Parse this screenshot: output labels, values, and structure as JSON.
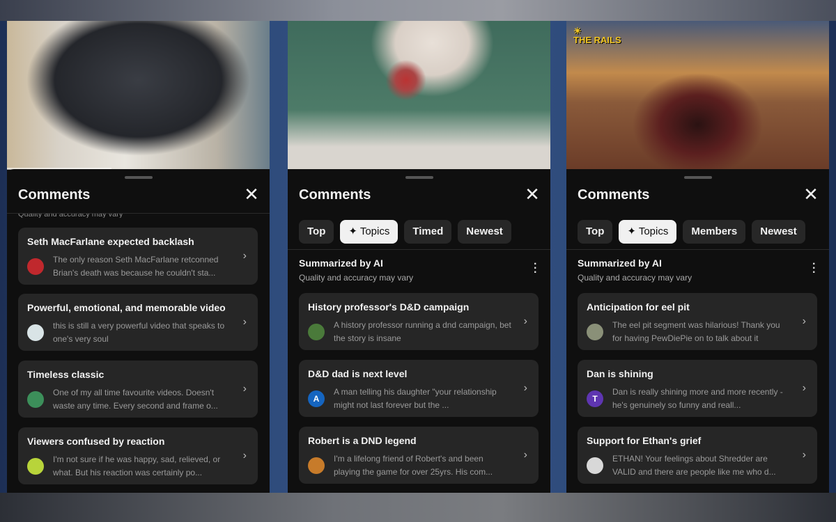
{
  "header_title": "Comments",
  "ai": {
    "title": "Summarized by AI",
    "subtitle": "Quality and accuracy may vary"
  },
  "panels": [
    {
      "chips": [],
      "cards": [
        {
          "title": "Seth MacFarlane expected backlash",
          "text": "The only reason Seth MacFarlane retconned Brian's death was because he couldn't sta...",
          "avatar": "",
          "avatar_color": "#c0282d"
        },
        {
          "title": "Powerful, emotional, and memorable video",
          "text": "this is still a very powerful video that speaks to one's very soul",
          "avatar": "",
          "avatar_color": "#d9e4e6"
        },
        {
          "title": "Timeless classic",
          "text": "One of my all time favourite videos. Doesn't waste any time. Every second and frame o...",
          "avatar": "",
          "avatar_color": "#3c8f5a"
        },
        {
          "title": "Viewers confused by reaction",
          "text": "I'm not sure if he was happy, sad, relieved, or what. But his reaction was certainly po...",
          "avatar": "",
          "avatar_color": "#b8d43a"
        }
      ]
    },
    {
      "chips": [
        "Top",
        "Topics",
        "Timed",
        "Newest"
      ],
      "active_chip": "Topics",
      "cards": [
        {
          "title": "History professor's D&D campaign",
          "text": "A history professor running a dnd campaign, bet the story is insane",
          "avatar": "",
          "avatar_color": "#4a7a3a"
        },
        {
          "title": "D&D dad is next level",
          "text": "A man telling his daughter \"your relationship might not last forever but the ...",
          "avatar": "A",
          "avatar_color": "#1565c0"
        },
        {
          "title": "Robert is a DND legend",
          "text": "I'm a lifelong friend of Robert's and been playing the game for over 25yrs. His com...",
          "avatar": "",
          "avatar_color": "#c77b2a"
        }
      ]
    },
    {
      "logo": "OFF THE RAILS",
      "chips": [
        "Top",
        "Topics",
        "Members",
        "Newest"
      ],
      "active_chip": "Topics",
      "cards": [
        {
          "title": "Anticipation for eel pit",
          "text": "The eel pit segment was hilarious! Thank you for having PewDiePie on to talk about it",
          "avatar": "",
          "avatar_color": "#8a9078"
        },
        {
          "title": "Dan is shining",
          "text": "Dan is really shining more and more recently - he's genuinely so funny and reall...",
          "avatar": "T",
          "avatar_color": "#5e35b1"
        },
        {
          "title": "Support for Ethan's grief",
          "text": "ETHAN! Your feelings about Shredder are VALID and there are people like me who d...",
          "avatar": "",
          "avatar_color": "#d8d8d8"
        }
      ]
    }
  ],
  "icons": {
    "close": "close-icon",
    "sparkle": "sparkle-icon",
    "more": "more-vert-icon",
    "chevron": "chevron-right-icon"
  }
}
